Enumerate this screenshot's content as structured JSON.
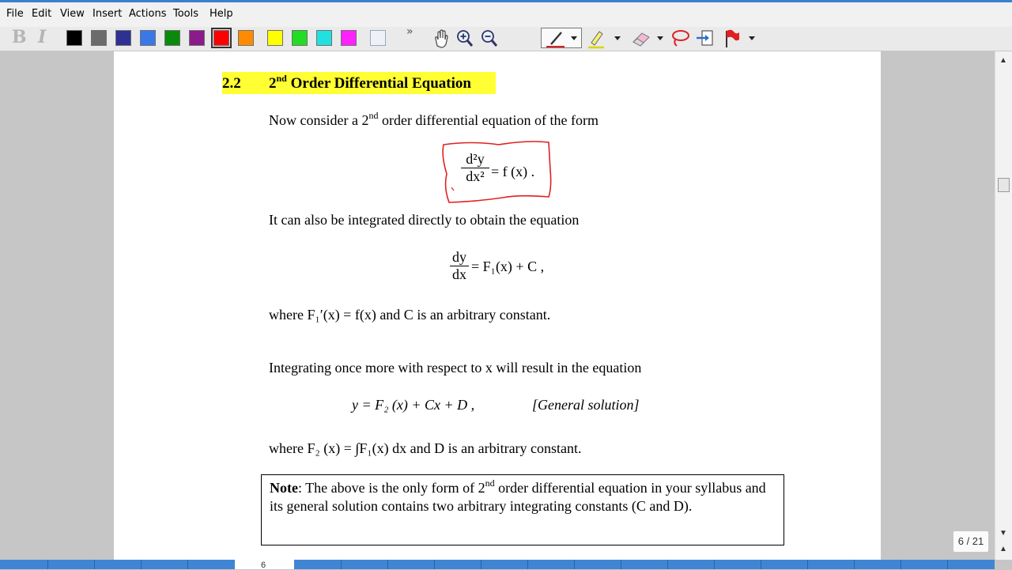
{
  "menu": [
    "File",
    "Edit",
    "View",
    "Insert",
    "Actions",
    "Tools",
    "Help"
  ],
  "toolbar": {
    "bold": "B",
    "italic": "I",
    "more": "»",
    "colors": [
      "#000000",
      "#6b6b6b",
      "#2e3192",
      "#3b78e7",
      "#0a8a0a",
      "#8b1a8b",
      "#ff0000",
      "#ff8c00",
      "#ffff00",
      "#22dd22",
      "#22e0e0",
      "#ff22ff"
    ],
    "selected_color": "#ff0000"
  },
  "doc": {
    "section_number": "2.2",
    "heading_prefix": "2",
    "heading_sup": "nd",
    "heading_rest": " Order Differential Equation",
    "p1_a": "Now consider a 2",
    "p1_sup": "nd",
    "p1_b": " order differential equation of the form",
    "eq1_num": "d²y",
    "eq1_den": "dx²",
    "eq1_rhs": "= f (x) .",
    "p2": "It can also be integrated directly to obtain the equation",
    "eq2_num": "dy",
    "eq2_den": "dx",
    "eq2_rhs": "= F₁(x) + C ,",
    "p3": "where F₁′(x) = f(x) and C is an arbitrary constant.",
    "p4": "Integrating once more with respect to x will result in the equation",
    "eq3": "y = F₂ (x) + Cx + D ,",
    "eq3_label": "[General solution]",
    "p5": "where F₂ (x) = ∫F₁(x) dx  and D is an arbitrary constant.",
    "note_label": "Note",
    "note_a": ": The above is the only form of 2",
    "note_sup": "nd",
    "note_b": " order differential equation in your syllabus and its general solution contains two arbitrary integrating constants (C and D)."
  },
  "page_indicator": "6 / 21",
  "page_number": "6",
  "annotation_color": "#e02020"
}
